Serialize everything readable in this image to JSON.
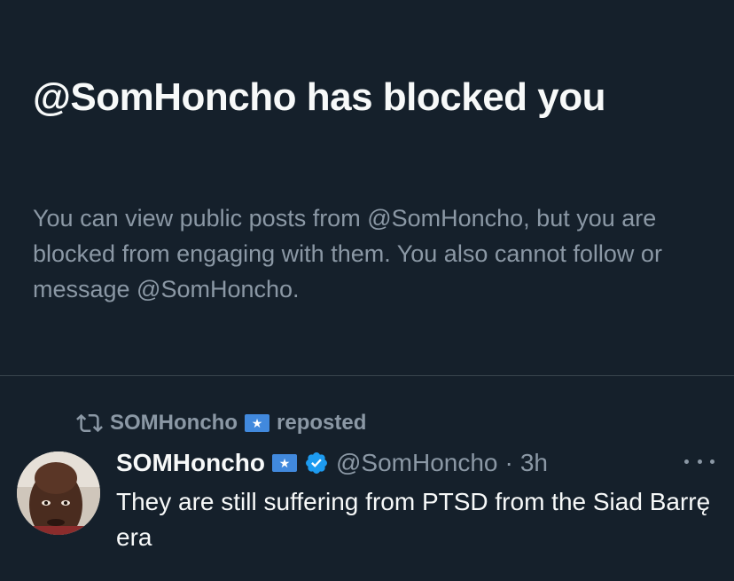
{
  "block_notice": {
    "title": "@SomHoncho has blocked you",
    "description": "You can view public posts from @SomHoncho, but you are blocked from engaging with them. You also cannot follow or message @SomHoncho."
  },
  "tweet": {
    "repost": {
      "icon": "repost-icon",
      "name": "SOMHoncho",
      "flag": "somalia-flag",
      "label": "reposted"
    },
    "author": {
      "name": "SOMHoncho",
      "flag": "somalia-flag",
      "verified": true,
      "handle": "@SomHoncho",
      "separator": "·",
      "time": "3h"
    },
    "text": "They are still suffering from PTSD from the Siad Barrę era"
  },
  "colors": {
    "background": "#15202b",
    "primary_text": "#f7f9f9",
    "secondary_text": "#8b98a5",
    "divider": "#38444d",
    "verified": "#1d9bf0",
    "flag_blue": "#4189dd"
  }
}
